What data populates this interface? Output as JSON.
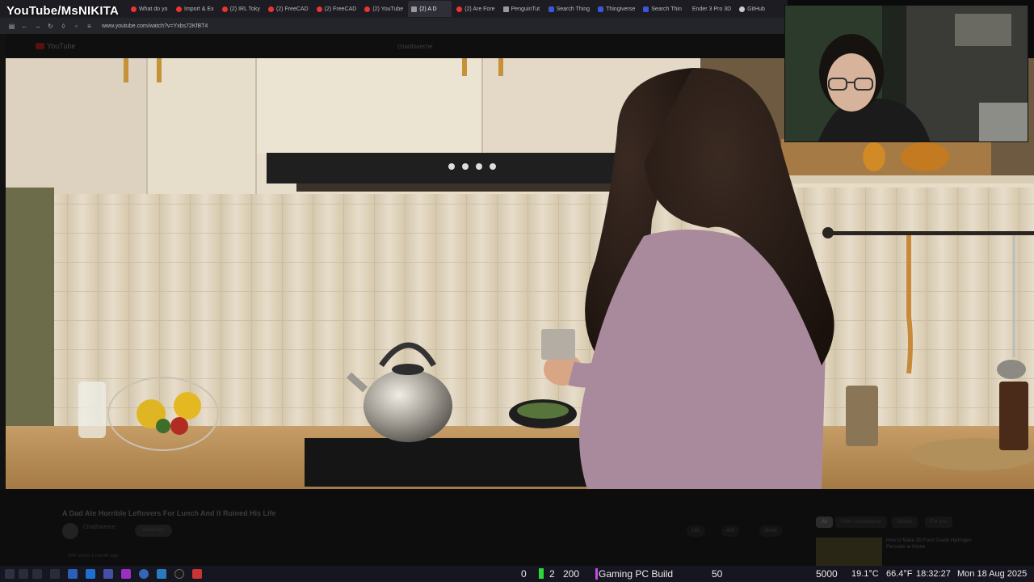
{
  "stream_title": "YouTube/MsNIKITA",
  "browser": {
    "tabs": [
      {
        "label": "What do yo",
        "icon": "youtube-icon",
        "active": false
      },
      {
        "label": "Import & Ex",
        "icon": "youtube-icon",
        "active": false
      },
      {
        "label": "(2) IRL Toky",
        "icon": "youtube-icon",
        "active": false
      },
      {
        "label": "(2) FreeCAD",
        "icon": "youtube-icon",
        "active": false
      },
      {
        "label": "(2) FreeCAD",
        "icon": "youtube-icon",
        "active": false
      },
      {
        "label": "(2) YouTube",
        "icon": "youtube-icon",
        "active": false
      },
      {
        "label": "(2) A D",
        "icon": "speaker-icon",
        "active": true
      },
      {
        "label": "(2) Are Fore",
        "icon": "youtube-icon",
        "active": false
      },
      {
        "label": "PenguinTut",
        "icon": "penguin-icon",
        "active": false
      },
      {
        "label": "Search Thing",
        "icon": "thingiverse-icon",
        "active": false
      },
      {
        "label": "Thingiverse",
        "icon": "thingiverse-icon",
        "active": false
      },
      {
        "label": "Search Thin",
        "icon": "thingiverse-icon",
        "active": false
      },
      {
        "label": "Ender 3 Pro 3D",
        "icon": "none",
        "active": false
      },
      {
        "label": "GitHub",
        "icon": "github-icon",
        "active": false
      }
    ],
    "url": "www.youtube.com/watch?v=Yxbs72KfBT4"
  },
  "youtube": {
    "logo": "YouTube",
    "search_text": "chadbwerne",
    "video_title": "A Dad Ate Horrible Leftovers For Lunch And It Ruined His Life",
    "channel_name": "Chadbwerne",
    "subscribe_label": "Subscribe",
    "like_label": "16K",
    "dislike_label": "499",
    "share_label": "Share",
    "description_line": "60K views  1 month ago",
    "chips": [
      "All",
      "From Chadbwerne",
      "Babies",
      "For you"
    ],
    "rec_title": "How to Make 3D Food Grade Hydrogen Peroxide at Home"
  },
  "taskbar": {
    "counter_a": "0",
    "counter_b": "2",
    "counter_c": "200",
    "scene_label": "Gaming PC Build",
    "counter_d": "50",
    "counter_e": "5000",
    "temp_c": "19.1°C",
    "temp_f": "66.4°F",
    "time": "18:32:27",
    "date": "Mon 18 Aug 2025"
  },
  "colors": {
    "green_indicator": "#2fd63a",
    "purple_indicator": "#c34be0",
    "youtube_red": "#e33333"
  }
}
